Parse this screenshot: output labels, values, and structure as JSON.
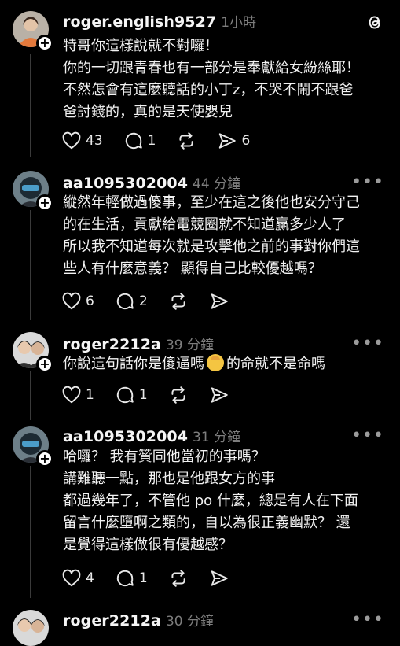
{
  "posts": [
    {
      "username": "roger.english9527",
      "time": "1小時",
      "lines": [
        "特哥你這樣說就不對囉！",
        "你的一切跟青春也有一部分是奉獻給女紛絲耶！",
        "不然怎會有這麼聽話的小丁z，不哭不鬧不跟爸",
        "爸討錢的，真的是天使嬰兒"
      ],
      "likes": "43",
      "replies": "1",
      "reposts": "",
      "shares": "6"
    },
    {
      "username": "aa1095302004",
      "time": "44 分鐘",
      "lines": [
        "縱然年輕做過傻事，至少在這之後他也安分守己",
        "的在生活，貢獻給電競圈就不知道贏多少人了",
        "所以我不知道每次就是攻擊他之前的事對你們這",
        "些人有什麼意義？ 顯得自己比較優越嗎？"
      ],
      "likes": "6",
      "replies": "2",
      "reposts": "",
      "shares": ""
    },
    {
      "username": "roger2212a",
      "time": "39 分鐘",
      "line_before_emoji": "你說這句話你是傻逼嗎",
      "line_after_emoji": "的命就不是命嗎",
      "likes": "1",
      "replies": "1",
      "reposts": "",
      "shares": ""
    },
    {
      "username": "aa1095302004",
      "time": "31 分鐘",
      "lines": [
        "哈囉？ 我有贊同他當初的事嗎？",
        "講難聽一點，那也是他跟女方的事",
        "都過幾年了，不管他 po 什麼，總是有人在下面",
        "留言什麼墮啊之類的，自以為很正義幽默？ 還",
        "是覺得這樣做很有優越感？"
      ],
      "likes": "4",
      "replies": "1",
      "reposts": "",
      "shares": ""
    },
    {
      "username": "roger2212a",
      "time": "30 分鐘"
    }
  ],
  "icons": {
    "like": "heart-icon",
    "reply": "comment-icon",
    "repost": "repost-icon",
    "share": "send-icon",
    "more": "more-icon",
    "app": "threads-logo-icon",
    "follow": "plus-icon"
  },
  "colors": {
    "background": "#000000",
    "text": "#f2f2f2",
    "muted": "#7d7d7d",
    "thread_line": "#3a3a3a"
  }
}
